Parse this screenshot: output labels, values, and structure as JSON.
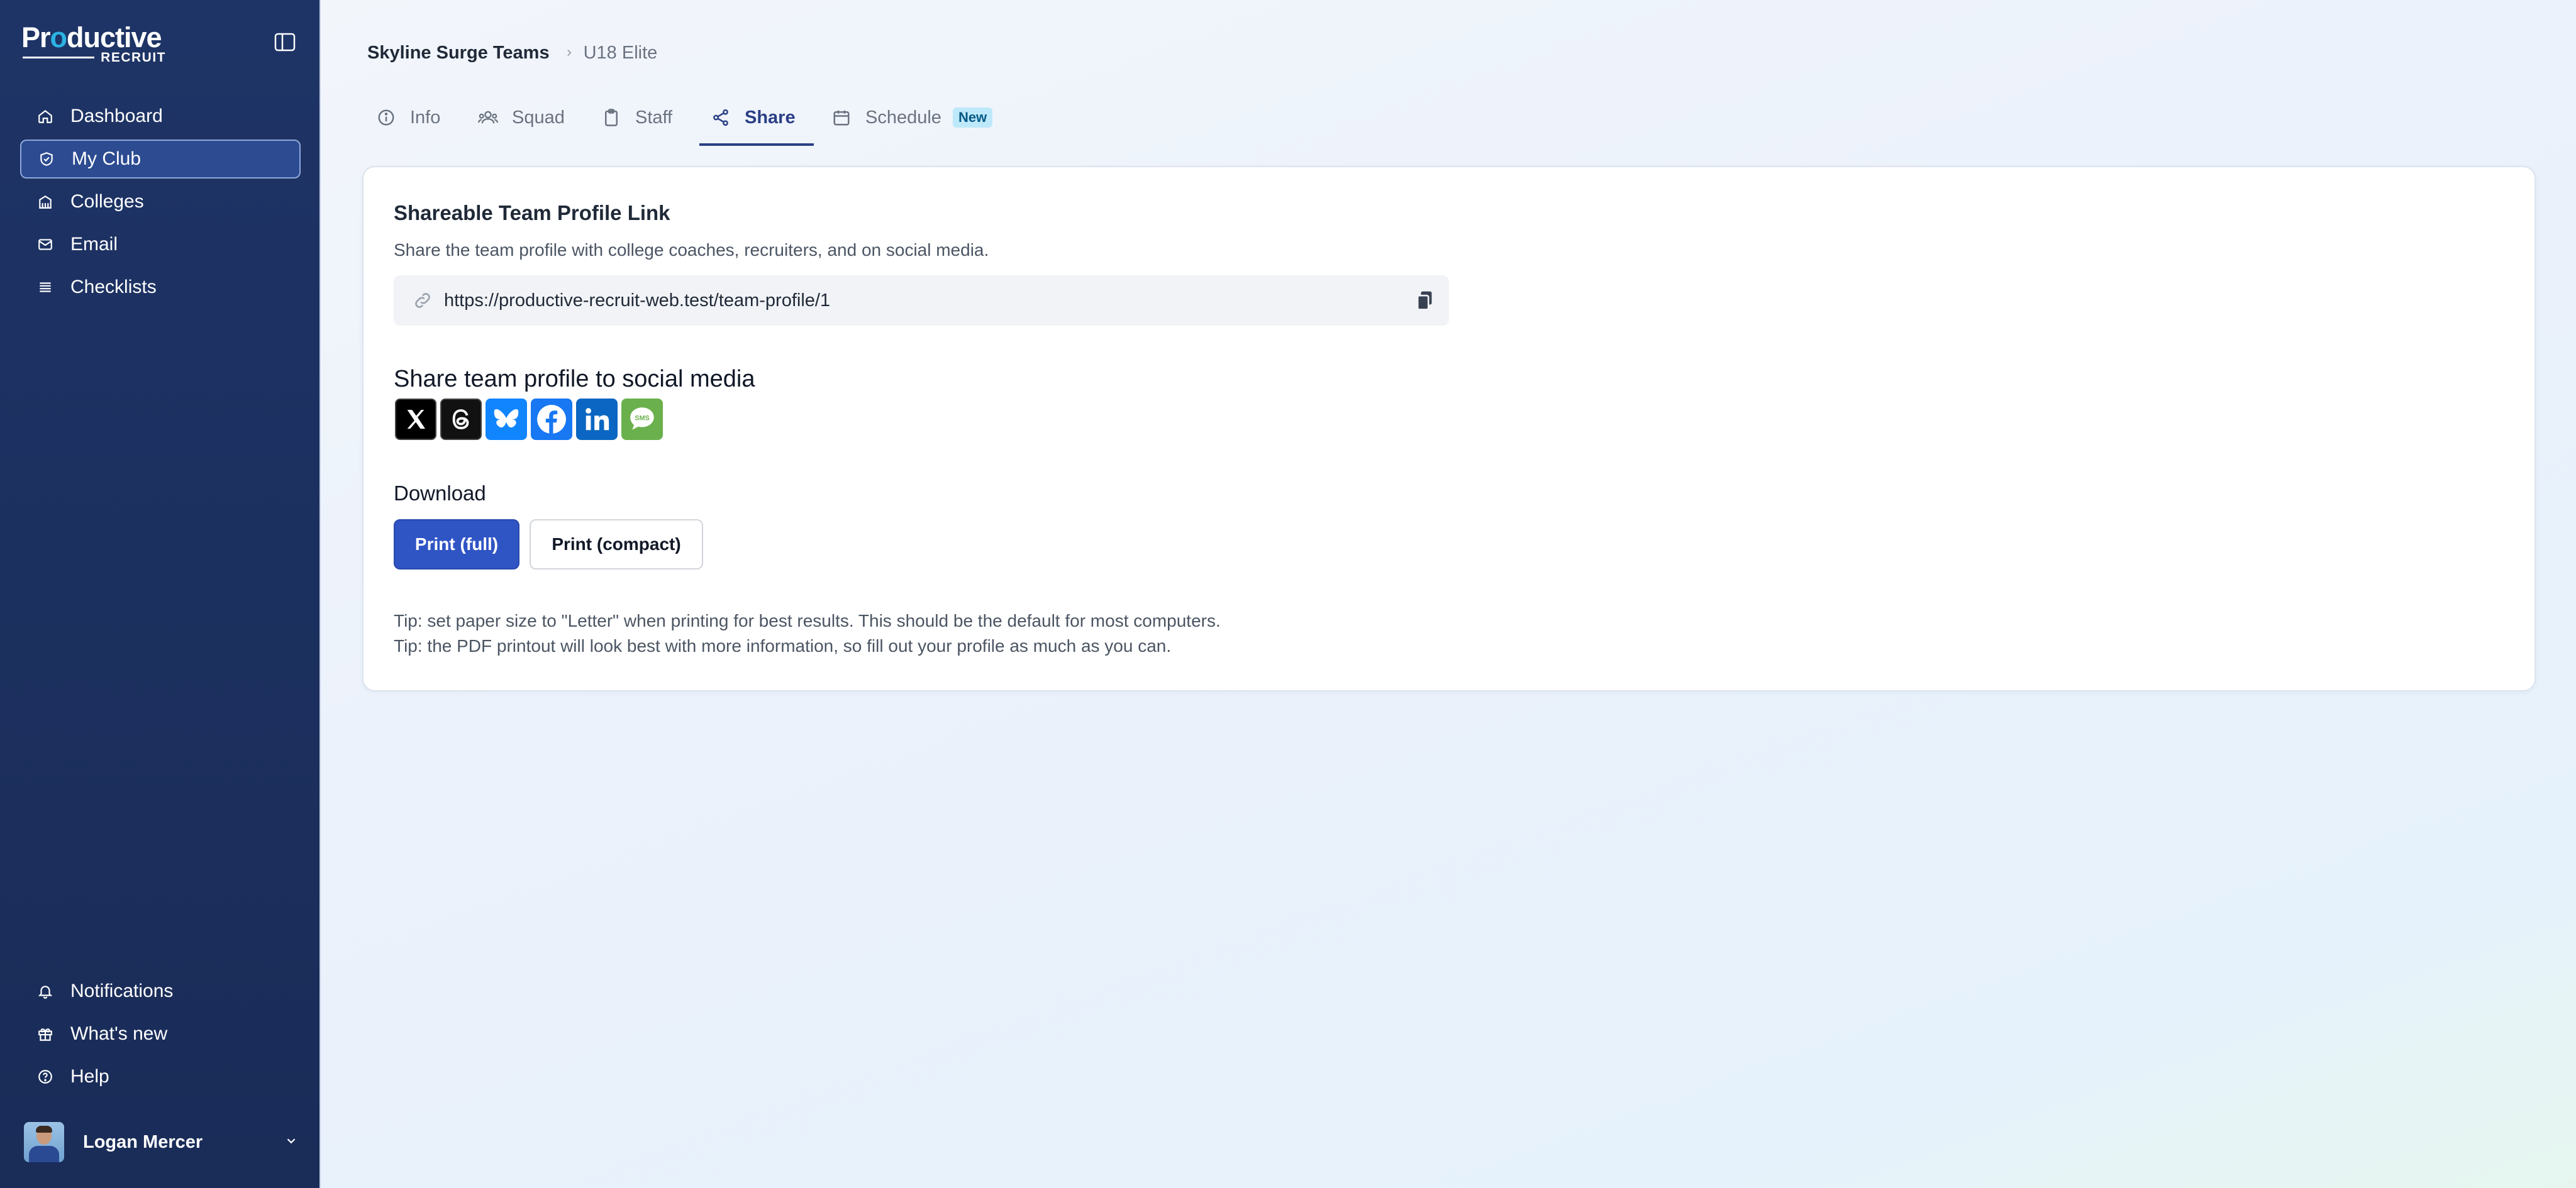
{
  "app": {
    "logo_main_pre": "Pr",
    "logo_main_o": "o",
    "logo_main_post": "ductive",
    "logo_sub": "RECRUIT"
  },
  "sidebar": {
    "items": [
      {
        "label": "Dashboard",
        "icon": "home-icon"
      },
      {
        "label": "My Club",
        "icon": "shield-icon",
        "active": true
      },
      {
        "label": "Colleges",
        "icon": "building-icon"
      },
      {
        "label": "Email",
        "icon": "mail-icon"
      },
      {
        "label": "Checklists",
        "icon": "list-icon"
      }
    ],
    "bottom_items": [
      {
        "label": "Notifications",
        "icon": "bell-icon"
      },
      {
        "label": "What's new",
        "icon": "gift-icon"
      },
      {
        "label": "Help",
        "icon": "help-circle-icon"
      }
    ],
    "user": {
      "name": "Logan Mercer"
    }
  },
  "breadcrumb": {
    "parent": "Skyline Surge Teams",
    "current": "U18 Elite"
  },
  "tabs": [
    {
      "label": "Info",
      "icon": "info-icon"
    },
    {
      "label": "Squad",
      "icon": "users-icon"
    },
    {
      "label": "Staff",
      "icon": "clipboard-icon"
    },
    {
      "label": "Share",
      "icon": "share-icon",
      "active": true
    },
    {
      "label": "Schedule",
      "icon": "calendar-icon",
      "badge": "New"
    }
  ],
  "share": {
    "link_title": "Shareable Team Profile Link",
    "link_desc": "Share the team profile with college coaches, recruiters, and on social media.",
    "url": "https://productive-recruit-web.test/team-profile/1",
    "social_title": "Share team profile to social media",
    "social": [
      "x-icon",
      "threads-icon",
      "bluesky-icon",
      "facebook-icon",
      "linkedin-icon",
      "sms-icon"
    ],
    "sms_text": "SMS",
    "download_title": "Download",
    "print_full": "Print (full)",
    "print_compact": "Print (compact)",
    "tip_1": "Tip: set paper size to \"Letter\" when printing for best results. This should be the default for most computers.",
    "tip_2": "Tip: the PDF printout will look best with more information, so fill out your profile as much as you can."
  },
  "colors": {
    "sidebar_bg": "#1e3466",
    "accent": "#2a3f86",
    "primary_button": "#2f54c4",
    "badge_bg": "#bde9fa"
  }
}
